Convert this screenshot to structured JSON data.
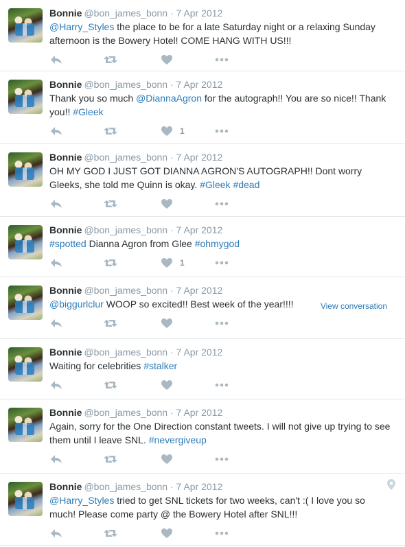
{
  "tweets": [
    {
      "name": "Bonnie",
      "handle": "@bon_james_bonn",
      "sep": "·",
      "time": "7 Apr 2012",
      "segments": [
        {
          "text": "@Harry_Styles",
          "link": true
        },
        {
          "text": " the place to be for a late Saturday night or a relaxing Sunday afternoon is the Bowery Hotel! COME HANG WITH US!!!",
          "link": false
        }
      ],
      "like_count": ""
    },
    {
      "name": "Bonnie",
      "handle": "@bon_james_bonn",
      "sep": "·",
      "time": "7 Apr 2012",
      "segments": [
        {
          "text": "Thank you so much ",
          "link": false
        },
        {
          "text": "@DiannaAgron",
          "link": true
        },
        {
          "text": " for the autograph!! You are so nice!! Thank you!! ",
          "link": false
        },
        {
          "text": "#Gleek",
          "link": true
        }
      ],
      "like_count": "1"
    },
    {
      "name": "Bonnie",
      "handle": "@bon_james_bonn",
      "sep": "·",
      "time": "7 Apr 2012",
      "segments": [
        {
          "text": "OH MY GOD I JUST GOT DIANNA AGRON'S AUTOGRAPH!! Dont worry Gleeks, she told me Quinn is okay. ",
          "link": false
        },
        {
          "text": "#Gleek",
          "link": true
        },
        {
          "text": " ",
          "link": false
        },
        {
          "text": "#dead",
          "link": true
        }
      ],
      "like_count": ""
    },
    {
      "name": "Bonnie",
      "handle": "@bon_james_bonn",
      "sep": "·",
      "time": "7 Apr 2012",
      "segments": [
        {
          "text": "#spotted",
          "link": true
        },
        {
          "text": " Dianna Agron from Glee ",
          "link": false
        },
        {
          "text": "#ohmygod",
          "link": true
        }
      ],
      "like_count": "1"
    },
    {
      "name": "Bonnie",
      "handle": "@bon_james_bonn",
      "sep": "·",
      "time": "7 Apr 2012",
      "segments": [
        {
          "text": "@biggurlclur",
          "link": true
        },
        {
          "text": " WOOP so excited!! Best week of the year!!!!",
          "link": false
        }
      ],
      "like_count": "",
      "view_conversation": "View conversation"
    },
    {
      "name": "Bonnie",
      "handle": "@bon_james_bonn",
      "sep": "·",
      "time": "7 Apr 2012",
      "segments": [
        {
          "text": "Waiting for celebrities ",
          "link": false
        },
        {
          "text": "#stalker",
          "link": true
        }
      ],
      "like_count": ""
    },
    {
      "name": "Bonnie",
      "handle": "@bon_james_bonn",
      "sep": "·",
      "time": "7 Apr 2012",
      "segments": [
        {
          "text": "Again, sorry for the One Direction constant tweets. I will not give up trying to see them until I leave SNL. ",
          "link": false
        },
        {
          "text": "#nevergiveup",
          "link": true
        }
      ],
      "like_count": ""
    },
    {
      "name": "Bonnie",
      "handle": "@bon_james_bonn",
      "sep": "·",
      "time": "7 Apr 2012",
      "segments": [
        {
          "text": "@Harry_Styles",
          "link": true
        },
        {
          "text": " tried to get SNL tickets for two weeks, can't :( I love you so much! Please come party @ the Bowery Hotel after SNL!!!",
          "link": false
        }
      ],
      "like_count": "",
      "location_icon": "map-pin-icon"
    }
  ],
  "icons": {
    "reply": "reply-icon",
    "retweet": "retweet-icon",
    "like": "heart-icon",
    "more": "more-dots-icon"
  },
  "colors": {
    "link": "#2b7bb9",
    "muted": "#8899a6",
    "action_icon": "#aab8c2",
    "divider": "#e1e8ed"
  }
}
